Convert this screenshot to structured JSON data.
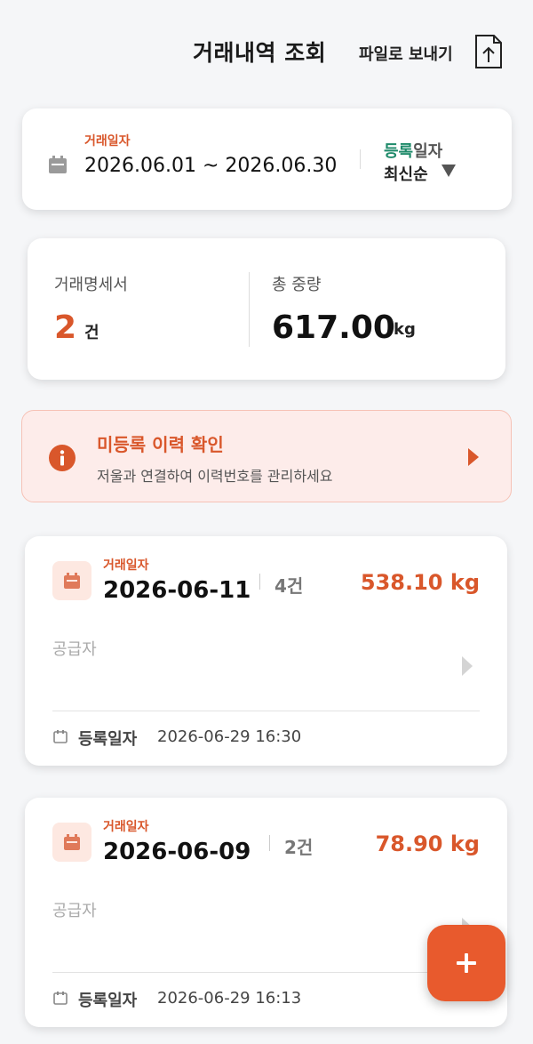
{
  "header": {
    "title": "거래내역 조회",
    "export_label": "파일로 보내기"
  },
  "filter": {
    "label": "거래일자",
    "date_range": "2026.06.01 ~ 2026.06.30",
    "sort_label_highlight": "등록",
    "sort_label_rest": "일자",
    "sort_value": "최신순"
  },
  "summary": {
    "statements_label": "거래명세서",
    "statements_count": "2",
    "statements_unit": "건",
    "total_weight_label": "총 중량",
    "total_weight_value": "617.00",
    "total_weight_unit": "kg"
  },
  "banner": {
    "title": "미등록 이력 확인",
    "description": "저울과 연결하여 이력번호를 관리하세요"
  },
  "transactions": [
    {
      "date_label": "거래일자",
      "date": "2026-06-11",
      "count": "4건",
      "weight": "538.10 kg",
      "supplier_label": "공급자",
      "registered_label": "등록일자",
      "registered_at": "2026-06-29 16:30"
    },
    {
      "date_label": "거래일자",
      "date": "2026-06-09",
      "count": "2건",
      "weight": "78.90 kg",
      "supplier_label": "공급자",
      "registered_label": "등록일자",
      "registered_at": "2026-06-29 16:13"
    }
  ],
  "colors": {
    "accent": "#d9572b",
    "fab": "#e85a2d",
    "sort_highlight": "#1f8a6a",
    "banner_bg": "#fdecea"
  },
  "icons": [
    "export-icon",
    "calendar-icon",
    "caret-down-icon",
    "info-icon",
    "chevron-right-icon",
    "plus-icon"
  ]
}
